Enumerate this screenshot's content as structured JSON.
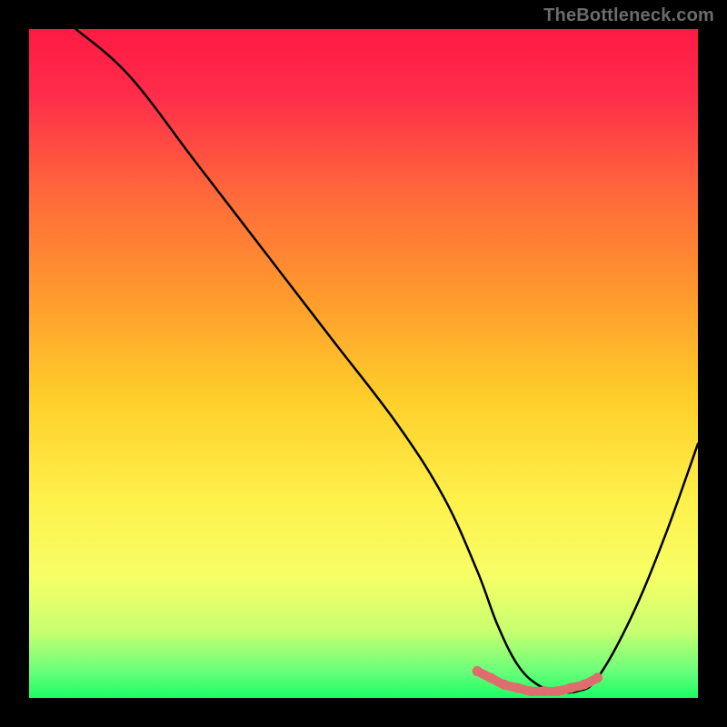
{
  "watermark": "TheBottleneck.com",
  "chart_data": {
    "type": "line",
    "title": "",
    "xlabel": "",
    "ylabel": "",
    "xlim": [
      0,
      100
    ],
    "ylim": [
      0,
      100
    ],
    "series": [
      {
        "name": "bottleneck-curve",
        "x": [
          7,
          15,
          25,
          35,
          45,
          55,
          62,
          67,
          70,
          73,
          76,
          79,
          82,
          85,
          90,
          95,
          100
        ],
        "y": [
          100,
          93,
          80,
          67,
          54,
          41,
          30,
          19,
          11,
          5,
          2,
          1,
          1,
          3,
          12,
          24,
          38
        ]
      },
      {
        "name": "bottom-highlight",
        "x": [
          67,
          69,
          71,
          73,
          75,
          77,
          79,
          81,
          83,
          85
        ],
        "y": [
          4,
          3,
          2,
          1.5,
          1,
          1,
          1,
          1.5,
          2,
          3
        ]
      }
    ],
    "gradient_stops": [
      {
        "pos": 0.0,
        "color": "#ff1a44"
      },
      {
        "pos": 0.1,
        "color": "#ff2d4a"
      },
      {
        "pos": 0.25,
        "color": "#ff6a3a"
      },
      {
        "pos": 0.4,
        "color": "#ff9a2d"
      },
      {
        "pos": 0.55,
        "color": "#ffce2a"
      },
      {
        "pos": 0.7,
        "color": "#fff04a"
      },
      {
        "pos": 0.82,
        "color": "#f6ff66"
      },
      {
        "pos": 0.9,
        "color": "#c8ff70"
      },
      {
        "pos": 0.96,
        "color": "#6aff7a"
      },
      {
        "pos": 1.0,
        "color": "#1aff66"
      }
    ],
    "curve_color": "#000000",
    "highlight_color": "#e06d6d"
  }
}
